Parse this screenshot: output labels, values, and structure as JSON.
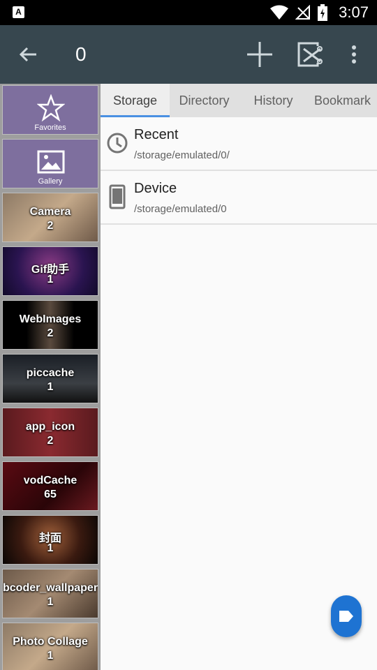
{
  "status_bar": {
    "time": "3:07",
    "app_badge": "A",
    "icons": [
      "wifi-icon",
      "no-signal-icon",
      "battery-charging-icon"
    ]
  },
  "toolbar": {
    "title": "0",
    "icons": [
      "back-arrow-icon",
      "add-icon",
      "select-icon",
      "more-vert-icon"
    ]
  },
  "tabs": {
    "items": [
      {
        "label": "Storage",
        "active": true
      },
      {
        "label": "Directory",
        "active": false
      },
      {
        "label": "History",
        "active": false
      },
      {
        "label": "Bookmark",
        "active": false
      }
    ]
  },
  "storage": {
    "items": [
      {
        "title": "Recent",
        "path": "/storage/emulated/0/",
        "icon": "clock-icon"
      },
      {
        "title": "Device",
        "path": "/storage/emulated/0",
        "icon": "phone-icon"
      }
    ]
  },
  "sidebar": {
    "favorites_label": "Favorites",
    "gallery_label": "Gallery",
    "folders": [
      {
        "name": "Camera",
        "count": "2"
      },
      {
        "name": "Gif助手",
        "count": "1"
      },
      {
        "name": "WebImages",
        "count": "2"
      },
      {
        "name": "piccache",
        "count": "1"
      },
      {
        "name": "app_icon",
        "count": "2"
      },
      {
        "name": "vodCache",
        "count": "65"
      },
      {
        "name": "封面",
        "count": "1"
      },
      {
        "name": "bcoder_wallpaper",
        "count": "1"
      },
      {
        "name": "Photo Collage",
        "count": "1"
      }
    ]
  },
  "colors": {
    "toolbar": "#37474f",
    "tab_indicator": "#4a90e2",
    "fab": "#1e73d2",
    "sidebar_tile": "#7e6f9e"
  }
}
